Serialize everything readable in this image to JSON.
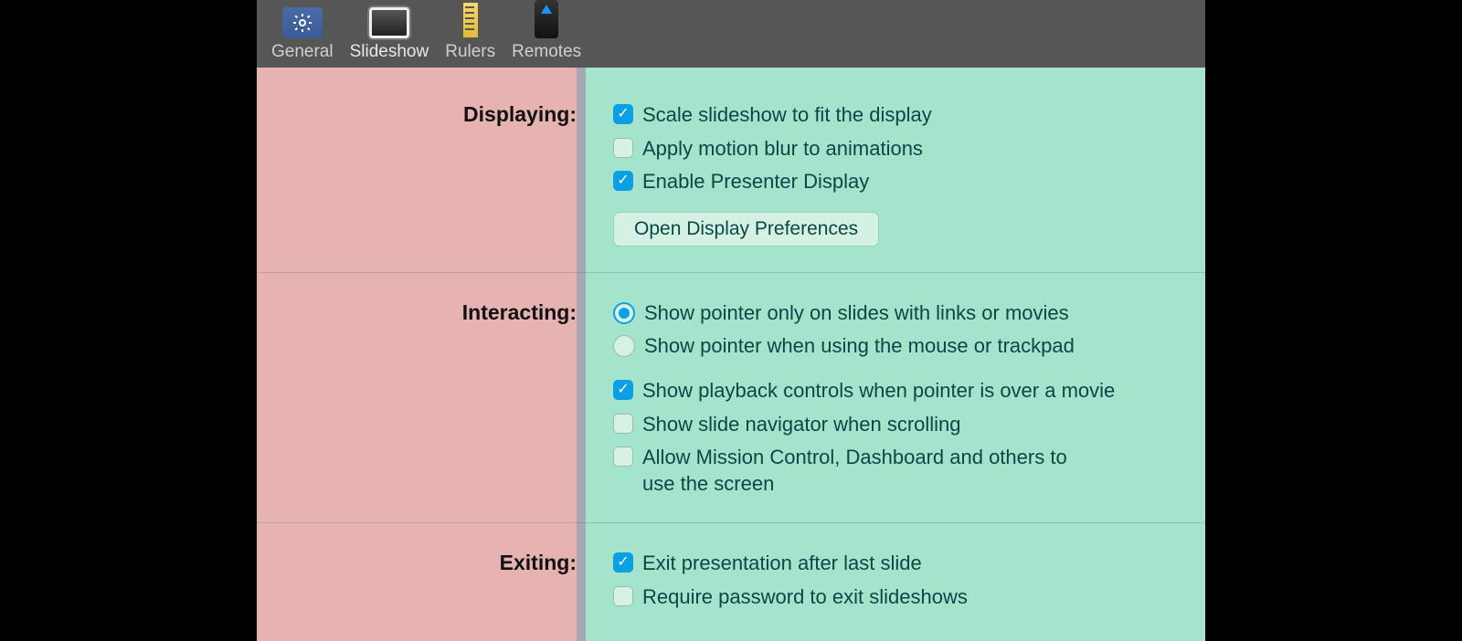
{
  "toolbar": {
    "tabs": [
      "General",
      "Slideshow",
      "Rulers",
      "Remotes"
    ],
    "active_index": 1
  },
  "sections": {
    "displaying": {
      "label": "Displaying:",
      "opts": [
        {
          "text": "Scale slideshow to fit the display",
          "checked": true
        },
        {
          "text": "Apply motion blur to animations",
          "checked": false
        },
        {
          "text": "Enable Presenter Display",
          "checked": true
        }
      ],
      "button": "Open Display Preferences"
    },
    "interacting": {
      "label": "Interacting:",
      "radios": [
        {
          "text": "Show pointer only on slides with links or movies",
          "selected": true
        },
        {
          "text": "Show pointer when using the mouse or trackpad",
          "selected": false
        }
      ],
      "checks": [
        {
          "text": "Show playback controls when pointer is over a movie",
          "checked": true
        },
        {
          "text": "Show slide navigator when scrolling",
          "checked": false
        },
        {
          "text": "Allow Mission Control, Dashboard and others to use the screen",
          "checked": false
        }
      ]
    },
    "exiting": {
      "label": "Exiting:",
      "checks": [
        {
          "text": "Exit presentation after last slide",
          "checked": true
        },
        {
          "text": "Require password to exit slideshows",
          "checked": false
        }
      ]
    }
  }
}
